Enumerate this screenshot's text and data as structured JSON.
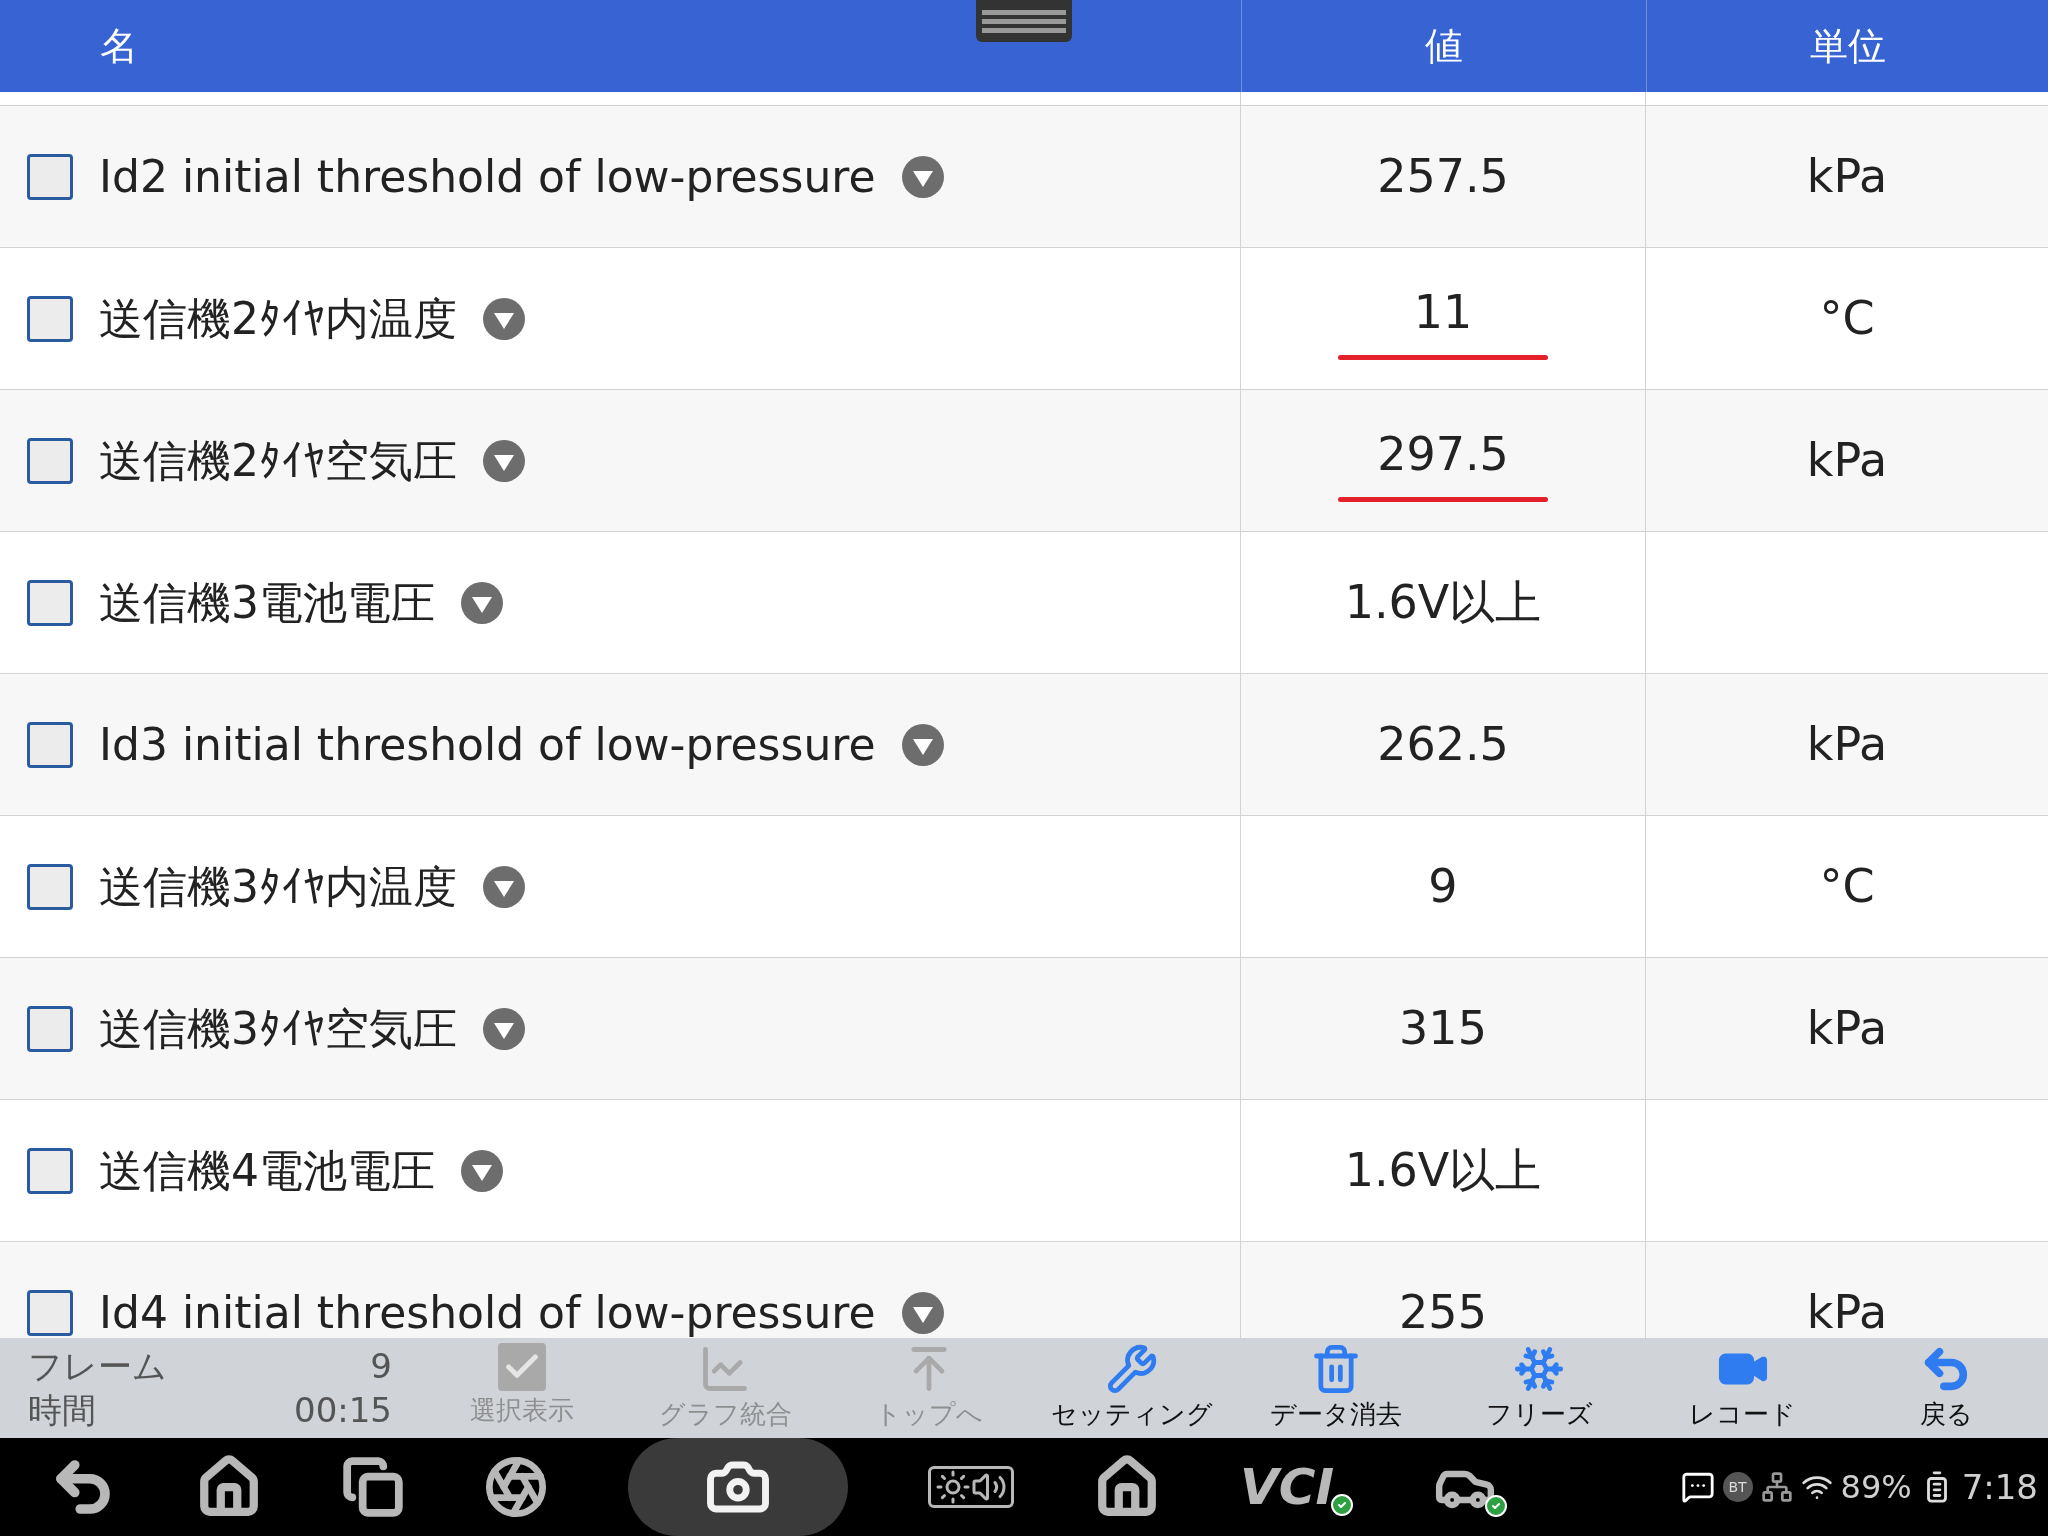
{
  "table": {
    "columns": [
      "名",
      "値",
      "単位"
    ],
    "rows": [
      {
        "name": "Id2 initial threshold of low-pressure",
        "checked": false,
        "value": "257.5",
        "unit": "kPa",
        "underlined": false
      },
      {
        "name": "送信機2ﾀｲﾔ内温度",
        "checked": false,
        "value": "11",
        "unit": "°C",
        "underlined": true
      },
      {
        "name": "送信機2ﾀｲﾔ空気圧",
        "checked": false,
        "value": "297.5",
        "unit": "kPa",
        "underlined": true
      },
      {
        "name": "送信機3電池電圧",
        "checked": false,
        "value": "1.6V以上",
        "unit": "",
        "underlined": false
      },
      {
        "name": "Id3 initial threshold of low-pressure",
        "checked": false,
        "value": "262.5",
        "unit": "kPa",
        "underlined": false
      },
      {
        "name": "送信機3ﾀｲﾔ内温度",
        "checked": false,
        "value": "9",
        "unit": "°C",
        "underlined": false
      },
      {
        "name": "送信機3ﾀｲﾔ空気圧",
        "checked": false,
        "value": "315",
        "unit": "kPa",
        "underlined": false
      },
      {
        "name": "送信機4電池電圧",
        "checked": false,
        "value": "1.6V以上",
        "unit": "",
        "underlined": false
      },
      {
        "name": "Id4 initial threshold of low-pressure",
        "checked": false,
        "value": "255",
        "unit": "kPa",
        "underlined": false
      }
    ]
  },
  "info": {
    "frame_label": "フレーム",
    "frame_value": "9",
    "time_label": "時間",
    "time_value": "00:15"
  },
  "toolbar": [
    {
      "kind": "select",
      "label": "選択表示",
      "disabled": true
    },
    {
      "kind": "graph",
      "label": "グラフ統合",
      "disabled": true
    },
    {
      "kind": "top",
      "label": "トップへ",
      "disabled": true
    },
    {
      "kind": "settings",
      "label": "セッティング",
      "disabled": false
    },
    {
      "kind": "clear",
      "label": "データ消去",
      "disabled": false
    },
    {
      "kind": "freeze",
      "label": "フリーズ",
      "disabled": false
    },
    {
      "kind": "record",
      "label": "レコード",
      "disabled": false
    },
    {
      "kind": "back",
      "label": "戻る",
      "disabled": false
    }
  ],
  "navbar": {
    "vci": "VCI",
    "bt": "BT",
    "battery": "89%",
    "time": "7:18"
  }
}
